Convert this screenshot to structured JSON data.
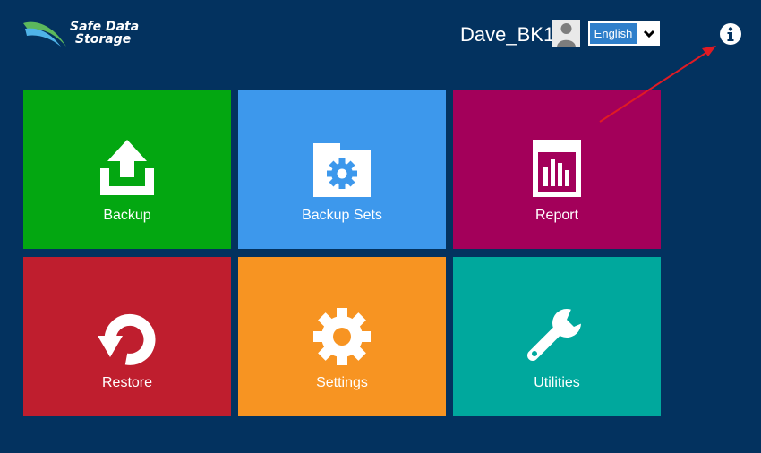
{
  "brand": {
    "line1": "Safe Data",
    "line2": "Storage"
  },
  "header": {
    "username": "Dave_BK1",
    "language": "English"
  },
  "icons": {
    "logo": "swoosh-logo-icon",
    "avatar": "user-silhouette-icon",
    "dropdown": "chevron-down-icon",
    "info": "info-icon"
  },
  "tiles": [
    {
      "label": "Backup",
      "color": "#03a711",
      "icon": "upload-icon"
    },
    {
      "label": "Backup Sets",
      "color": "#3d98ec",
      "icon": "folder-gear-icon"
    },
    {
      "label": "Report",
      "color": "#a3005a",
      "icon": "bar-chart-icon"
    },
    {
      "label": "Restore",
      "color": "#bf1e2e",
      "icon": "restore-icon"
    },
    {
      "label": "Settings",
      "color": "#f79422",
      "icon": "gear-icon"
    },
    {
      "label": "Utilities",
      "color": "#00a89d",
      "icon": "wrench-icon"
    }
  ],
  "colors": {
    "background": "#03325f",
    "annotation_arrow": "#e01b24"
  }
}
